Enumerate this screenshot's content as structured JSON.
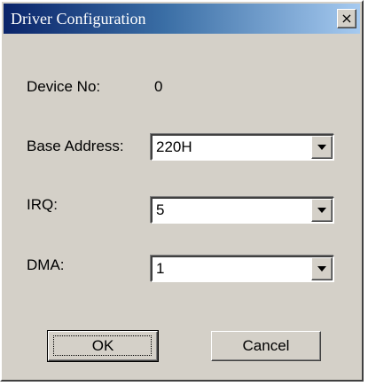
{
  "window": {
    "title": "Driver Configuration",
    "close_glyph": "×",
    "close_icon": "close-icon"
  },
  "form": {
    "device_no": {
      "label": "Device No:",
      "value": "0"
    },
    "base_address": {
      "label": "Base Address:",
      "value": "220H"
    },
    "irq": {
      "label": "IRQ:",
      "value": "5"
    },
    "dma": {
      "label": "DMA:",
      "value": "1"
    }
  },
  "buttons": {
    "ok_label": "OK",
    "cancel_label": "Cancel"
  },
  "colors": {
    "face": "#d4d0c8",
    "title_start": "#0a246a",
    "title_end": "#a6caf0"
  }
}
